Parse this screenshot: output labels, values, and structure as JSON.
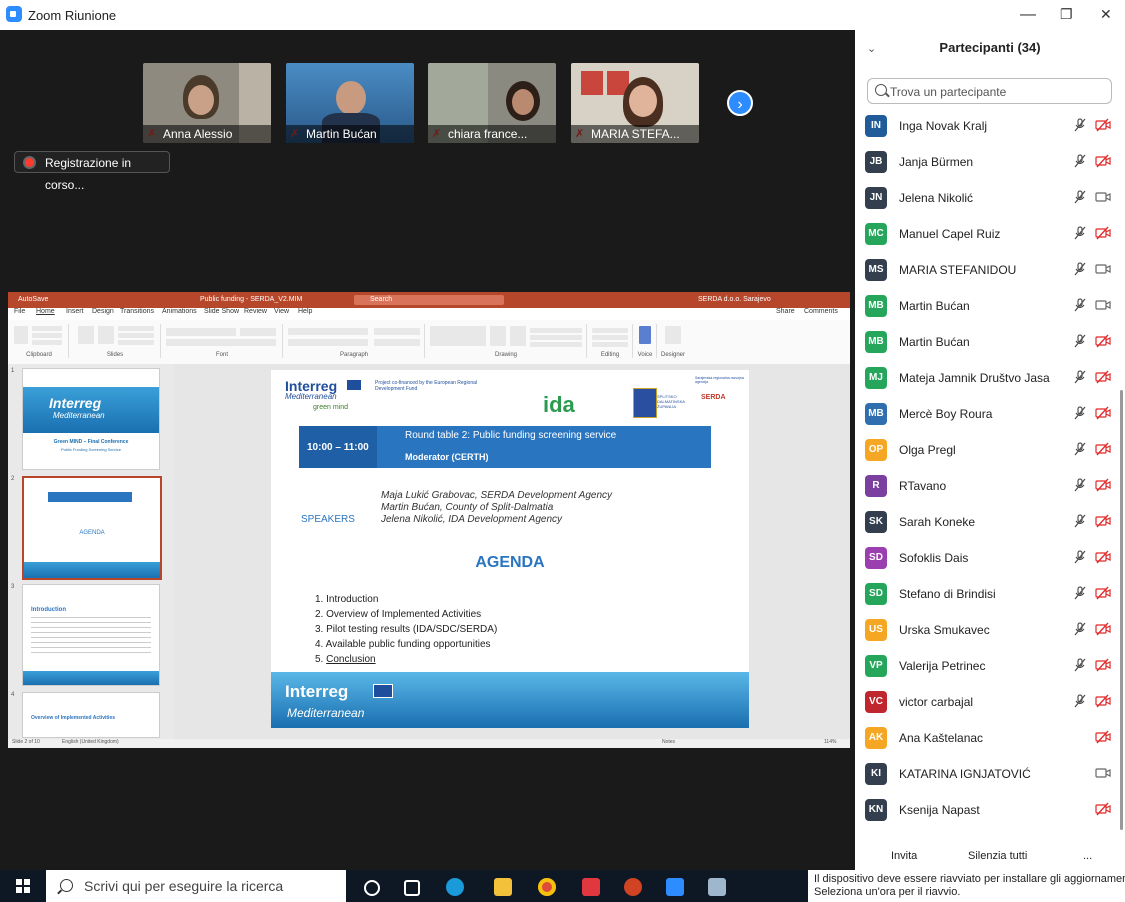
{
  "window": {
    "title": "Zoom Riunione",
    "minimize": "—",
    "restore": "❐",
    "close": "✕"
  },
  "video_strip": {
    "thumbs": [
      {
        "name": "Anna Alessio"
      },
      {
        "name": "Martin Bućan"
      },
      {
        "name": "chiara france..."
      },
      {
        "name": "MARIA STEFA..."
      }
    ],
    "next_icon": "›"
  },
  "recording": {
    "label": "Registrazione in corso..."
  },
  "ppt": {
    "titlebar": {
      "autosave": "AutoSave",
      "file": "Public funding - SERDA_V2.MIM",
      "search": "Search",
      "account": "SERDA d.o.o. Sarajevo"
    },
    "menu": [
      "File",
      "Home",
      "Insert",
      "Design",
      "Transitions",
      "Animations",
      "Slide Show",
      "Review",
      "View",
      "Help"
    ],
    "share": "Share",
    "comments": "Comments",
    "ribbon_groups": [
      "Clipboard",
      "Slides",
      "Font",
      "Paragraph",
      "Drawing",
      "Editing",
      "Voice",
      "Designer"
    ],
    "status_left": "Slide 2 of 10",
    "status_lang": "English (United Kingdom)",
    "status_notes": "Notes",
    "status_zoom": "114%",
    "thumb1": {
      "num": "1",
      "title": "Green MIND – Final Conference",
      "subtitle": "Public Funding Screening Service",
      "brand": "Interreg",
      "brand2": "Mediterranean"
    },
    "thumb2": {
      "num": "2",
      "heading": "AGENDA"
    },
    "thumb3": {
      "num": "3",
      "heading": "Introduction"
    },
    "thumb4": {
      "num": "4",
      "heading": "Overview of Implemented Activities"
    },
    "slide": {
      "brand": "Interreg",
      "brand_sub": "Mediterranean",
      "brand_tag": "green mind",
      "funded_by": "Project co-financed by the European Regional Development Fund",
      "ida_logo": "ida",
      "county": "SPLITSKO DALMATINSKA ŽUPANIJA",
      "serda": "SERDA",
      "agency": "Sarajevska regionalna razvojna agencija",
      "time": "10:00 – 11:00",
      "round_table": "Round table 2: Public funding screening service",
      "moderator": "Moderator (CERTH)",
      "speakers_label": "SPEAKERS",
      "speakers": [
        "Maja Lukić Grabovac, SERDA Development Agency",
        "Martin Bućan, County of Split-Dalmatia",
        "Jelena Nikolić, IDA Development Agency"
      ],
      "agenda_title": "AGENDA",
      "agenda": [
        "Introduction",
        "Overview of Implemented Activities",
        "Pilot testing results (IDA/SDC/SERDA)",
        "Available public funding opportunities",
        "Conclusion"
      ],
      "agenda_nums": [
        "1.",
        "2.",
        "3.",
        "4.",
        "5."
      ],
      "footer_brand": "Interreg",
      "footer_sub": "Mediterranean"
    }
  },
  "participants": {
    "header": "Partecipanti (34)",
    "search_placeholder": "Trova un partecipante",
    "list": [
      {
        "initials": "IN",
        "name": "Inga Novak Kralj",
        "color": "#1f5c99",
        "mic": "off",
        "cam": "off"
      },
      {
        "initials": "JB",
        "name": "Janja Bürmen",
        "color": "#333f4f",
        "mic": "off",
        "cam": "off"
      },
      {
        "initials": "JN",
        "name": "Jelena Nikolić",
        "color": "#333f4f",
        "mic": "off",
        "cam": "on"
      },
      {
        "initials": "MC",
        "name": "Manuel Capel Ruiz",
        "color": "#26a65b",
        "mic": "off",
        "cam": "off"
      },
      {
        "initials": "MS",
        "name": "MARIA STEFANIDOU",
        "color": "#333f4f",
        "mic": "off",
        "cam": "on"
      },
      {
        "initials": "MB",
        "name": "Martin Bućan",
        "color": "#26a65b",
        "mic": "off",
        "cam": "on"
      },
      {
        "initials": "MB",
        "name": "Martin Bućan",
        "color": "#26a65b",
        "mic": "off",
        "cam": "off"
      },
      {
        "initials": "MJ",
        "name": "Mateja Jamnik Društvo Jasa",
        "color": "#26a65b",
        "mic": "off",
        "cam": "off"
      },
      {
        "initials": "MB",
        "name": "Mercè Boy Roura",
        "color": "#2f6fb0",
        "mic": "off",
        "cam": "off"
      },
      {
        "initials": "OP",
        "name": "Olga Pregl",
        "color": "#f5a623",
        "mic": "off",
        "cam": "off"
      },
      {
        "initials": "R",
        "name": "RTavano",
        "color": "#7b3fa0",
        "mic": "off",
        "cam": "off"
      },
      {
        "initials": "SK",
        "name": "Sarah Koneke",
        "color": "#333f4f",
        "mic": "off",
        "cam": "off"
      },
      {
        "initials": "SD",
        "name": "Sofoklis Dais",
        "color": "#9b3fb0",
        "mic": "off",
        "cam": "off"
      },
      {
        "initials": "SD",
        "name": "Stefano di Brindisi",
        "color": "#26a65b",
        "mic": "off",
        "cam": "off"
      },
      {
        "initials": "US",
        "name": "Urska Smukavec",
        "color": "#f5a623",
        "mic": "off",
        "cam": "off"
      },
      {
        "initials": "VP",
        "name": "Valerija Petrinec",
        "color": "#26a65b",
        "mic": "off",
        "cam": "off"
      },
      {
        "initials": "VC",
        "name": "victor carbajal",
        "color": "#c0262e",
        "mic": "off",
        "cam": "off"
      },
      {
        "initials": "AK",
        "name": "Ana Kaštelanac",
        "color": "#f5a623",
        "mic": "none",
        "cam": "off"
      },
      {
        "initials": "KI",
        "name": "KATARINA IGNJATOVIĆ",
        "color": "#333f4f",
        "mic": "none",
        "cam": "on"
      },
      {
        "initials": "KN",
        "name": "Ksenija Napast",
        "color": "#333f4f",
        "mic": "none",
        "cam": "off"
      }
    ],
    "footer": {
      "invite": "Invita",
      "mute_all": "Silenzia tutti",
      "more": "..."
    }
  },
  "taskbar": {
    "search_placeholder": "Scrivi qui per eseguire la ricerca",
    "notification_line1": "Il dispositivo deve essere riavviato per installare gli aggiornamenti.",
    "notification_line2": "Seleziona un'ora per il riavvio."
  }
}
